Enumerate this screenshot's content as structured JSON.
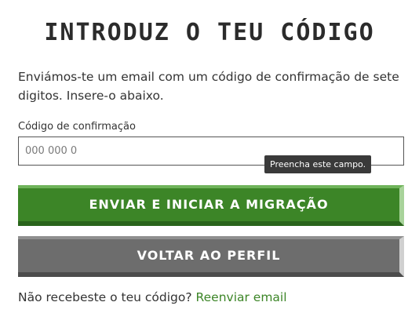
{
  "heading": "INTRODUZ O TEU CÓDIGO",
  "intro_text": "Enviámos-te um email com um código de confirmação de sete digitos. Insere-o abaixo.",
  "code_field": {
    "label": "Código de confirmação",
    "placeholder": "000 000 0",
    "value": "",
    "validation_tooltip": "Preencha este campo."
  },
  "buttons": {
    "submit_label": "ENVIAR E INICIAR A MIGRAÇÃO",
    "back_label": "VOLTAR AO PERFIL"
  },
  "resend": {
    "prompt": "Não recebeste o teu código?",
    "link_label": "Reenviar email"
  },
  "colors": {
    "primary_green": "#3c8527",
    "secondary_gray": "#6d6d6d",
    "link_green": "#3c8527",
    "tooltip_bg": "#3a3a3a"
  }
}
